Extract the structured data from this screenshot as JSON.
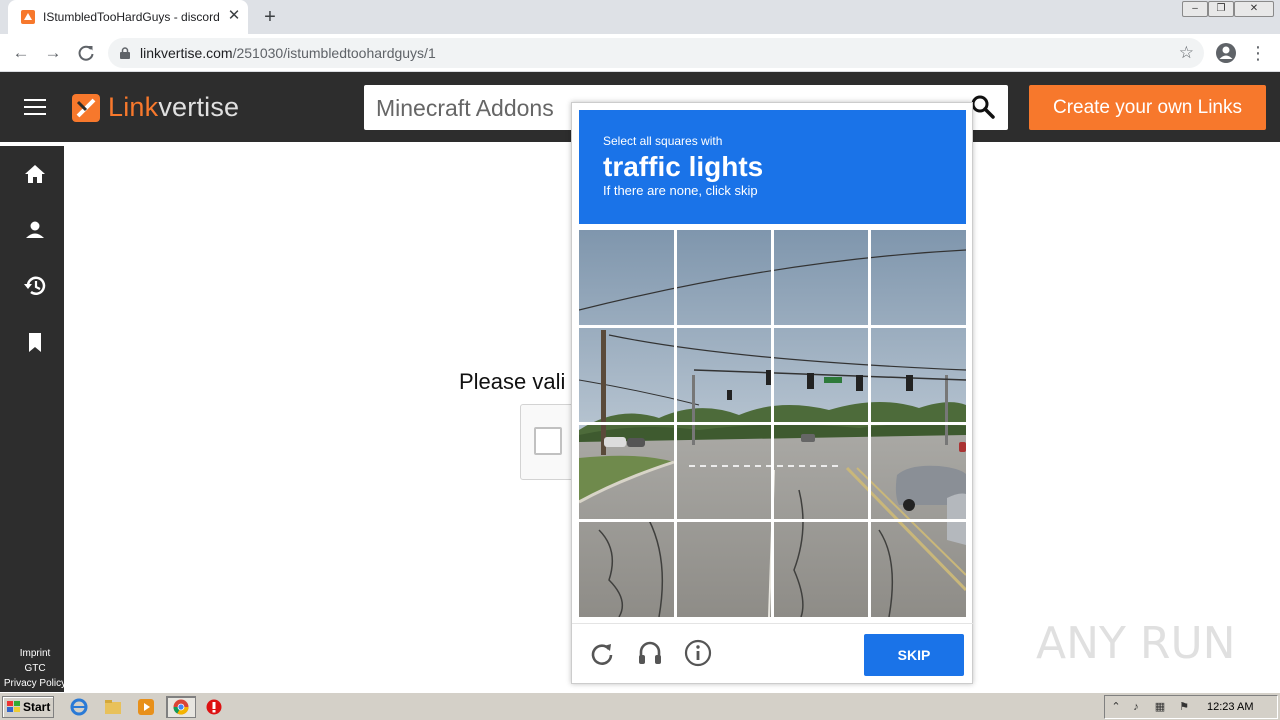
{
  "browser": {
    "tab_title": "IStumbledTooHardGuys - discord.gg",
    "tab_close": "✕",
    "new_tab": "+",
    "url_host": "linkvertise.com",
    "url_path": "/251030/istumbledtoohardguys/1",
    "window_buttons": [
      "‒",
      "❐",
      "✕"
    ]
  },
  "site": {
    "logo_link": "Link",
    "logo_vertise": "vertise",
    "search_text": "Minecraft Addons",
    "create_button": "Create your own Links",
    "footer_links": [
      "Imprint",
      "GTC",
      "Privacy Policy"
    ],
    "validate_text": "Please vali"
  },
  "captcha": {
    "instruction_small": "Select all squares with",
    "instruction_big": "traffic lights",
    "instruction_sub": "If there are none, click skip",
    "skip_label": "SKIP"
  },
  "watermark": "ANY RUN",
  "taskbar": {
    "start_label": "Start",
    "clock": "12:23 AM"
  },
  "colors": {
    "captcha_blue": "#1a73e8",
    "brand_orange": "#f7782c",
    "header_dark": "#2d2d2d"
  }
}
